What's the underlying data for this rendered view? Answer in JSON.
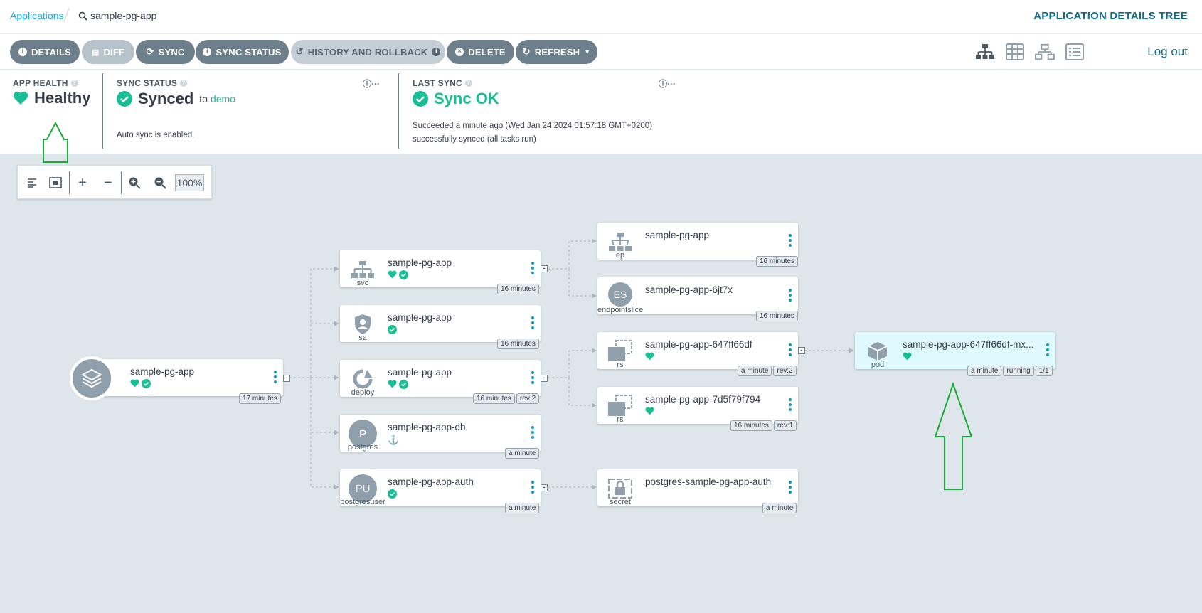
{
  "breadcrumb": {
    "root": "Applications",
    "app": "sample-pg-app"
  },
  "page_title": "APPLICATION DETAILS TREE",
  "toolbar": {
    "details": "DETAILS",
    "diff": "DIFF",
    "sync": "SYNC",
    "sync_status": "SYNC STATUS",
    "history": "HISTORY AND ROLLBACK",
    "delete": "DELETE",
    "refresh": "REFRESH",
    "logout": "Log out"
  },
  "status": {
    "app_health_label": "APP HEALTH",
    "app_health_value": "Healthy",
    "sync_status_label": "SYNC STATUS",
    "sync_status_value": "Synced",
    "sync_to": "to",
    "sync_target": "demo",
    "auto_sync": "Auto sync is enabled.",
    "last_sync_label": "LAST SYNC",
    "last_sync_value": "Sync OK",
    "last_sync_time": "Succeeded a minute ago (Wed Jan 24 2024 01:57:18 GMT+0200)",
    "last_sync_msg": "successfully synced (all tasks run)"
  },
  "zoom": {
    "level": "100%"
  },
  "nodes": {
    "app": {
      "name": "sample-pg-app",
      "age": "17 minutes"
    },
    "svc": {
      "name": "sample-pg-app",
      "type": "svc",
      "age": "16 minutes"
    },
    "sa": {
      "name": "sample-pg-app",
      "type": "sa",
      "age": "16 minutes"
    },
    "deploy": {
      "name": "sample-pg-app",
      "type": "deploy",
      "age": "16 minutes",
      "rev": "rev:2"
    },
    "postgres": {
      "name": "sample-pg-app-db",
      "type": "postgres",
      "icon_text": "P",
      "age": "a minute"
    },
    "pguser": {
      "name": "sample-pg-app-auth",
      "type": "postgresuser",
      "icon_text": "PU",
      "age": "a minute"
    },
    "ep": {
      "name": "sample-pg-app",
      "type": "ep",
      "age": "16 minutes"
    },
    "es": {
      "name": "sample-pg-app-6jt7x",
      "type": "endpointslice",
      "icon_text": "ES",
      "age": "16 minutes"
    },
    "rs1": {
      "name": "sample-pg-app-647ff66df",
      "type": "rs",
      "age": "a minute",
      "rev": "rev:2"
    },
    "rs2": {
      "name": "sample-pg-app-7d5f79f794",
      "type": "rs",
      "age": "16 minutes",
      "rev": "rev:1"
    },
    "secret": {
      "name": "postgres-sample-pg-app-auth",
      "type": "secret",
      "age": "a minute"
    },
    "pod": {
      "name": "sample-pg-app-647ff66df-mx...",
      "type": "pod",
      "age": "a minute",
      "state": "running",
      "ready": "1/1"
    }
  },
  "colors": {
    "healthy": "#18be94",
    "accent": "#0dadea",
    "arrow": "#1aab3a"
  }
}
